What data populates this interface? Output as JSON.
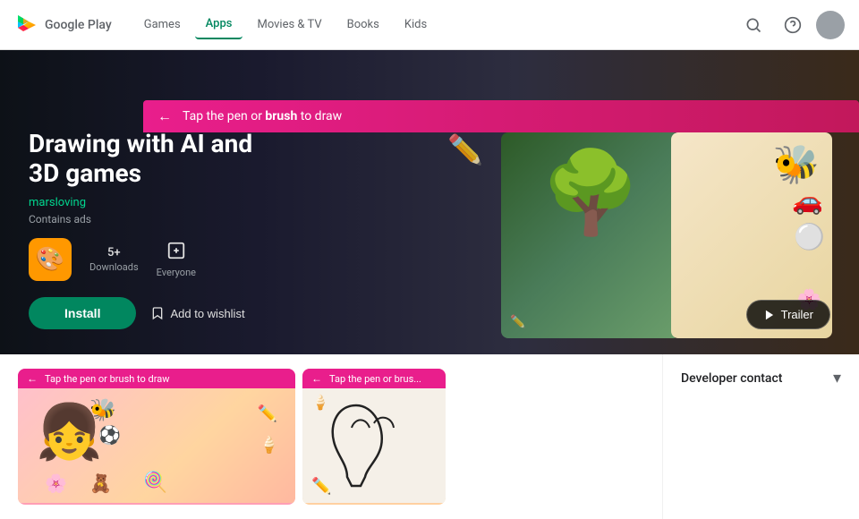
{
  "navbar": {
    "logo_text": "Google Play",
    "links": [
      {
        "label": "Games",
        "active": false
      },
      {
        "label": "Apps",
        "active": true
      },
      {
        "label": "Movies & TV",
        "active": false
      },
      {
        "label": "Books",
        "active": false
      },
      {
        "label": "Kids",
        "active": false
      }
    ]
  },
  "hero": {
    "banner_text": "Tap the pen or brush to draw",
    "banner_highlight": "brush",
    "app_title": "Drawing with AI and\n3D games",
    "developer": "marsloving",
    "contains_ads": "Contains ads",
    "downloads_value": "5+",
    "downloads_label": "Downloads",
    "rating_icon": "everyone",
    "rating_label": "Everyone",
    "install_label": "Install",
    "wishlist_label": "Add to wishlist",
    "trailer_label": "Trailer"
  },
  "screenshots": [
    {
      "banner": "Tap the pen or brush to draw",
      "description": "Girl character with stickers"
    },
    {
      "banner": "Tap the pen or brus...",
      "description": "Drawing outline"
    }
  ],
  "sidebar": {
    "developer_contact_label": "Developer contact",
    "chevron": "▾"
  }
}
